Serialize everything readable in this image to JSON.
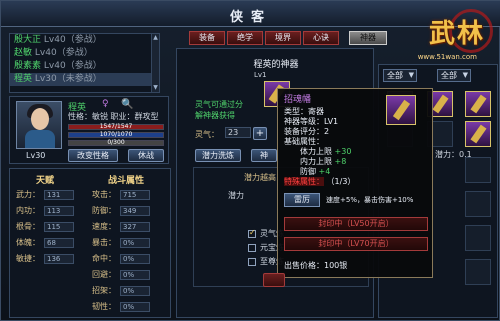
{
  "window": {
    "title": "侠客"
  },
  "logo": {
    "text": "武林",
    "url": "www.51wan.com"
  },
  "list": {
    "rows": [
      {
        "name": "殷大正",
        "level": "Lv40",
        "status": "（参战）",
        "selected": false
      },
      {
        "name": "赵敏",
        "level": "Lv40",
        "status": "（参战）",
        "selected": false
      },
      {
        "name": "殷素素",
        "level": "Lv40",
        "status": "（参战）",
        "selected": false
      },
      {
        "name": "程英",
        "level": "Lv30",
        "status": "（未参战）",
        "selected": true
      }
    ]
  },
  "character": {
    "name": "程英",
    "trait_line": "性格：敏锐    职业：群攻型",
    "level": "Lv30",
    "hp_text": "1547/1547",
    "mp_text": "1070/1070",
    "xp_text": "0/300",
    "change_button": "改变性格",
    "fight_button": "休战"
  },
  "stats": {
    "talent_title": "天赋",
    "battle_title": "战斗属性",
    "talent": [
      {
        "k": "武力：",
        "v": "131"
      },
      {
        "k": "内功：",
        "v": "113"
      },
      {
        "k": "根骨：",
        "v": "115"
      },
      {
        "k": "体魄：",
        "v": "68"
      },
      {
        "k": "敏捷：",
        "v": "136"
      }
    ],
    "battle": [
      {
        "k": "攻击：",
        "v": "715"
      },
      {
        "k": "防御：",
        "v": "349"
      },
      {
        "k": "速度：",
        "v": "327"
      },
      {
        "k": "暴击：",
        "v": "0%"
      },
      {
        "k": "命中：",
        "v": "0%"
      },
      {
        "k": "回避：",
        "v": "0%"
      },
      {
        "k": "招架：",
        "v": "0%"
      },
      {
        "k": "韧性：",
        "v": "0%"
      }
    ]
  },
  "tabs": [
    "装备",
    "绝学",
    "境界",
    "心诀",
    "神器"
  ],
  "main": {
    "title": "程英的神器",
    "level": "Lv1",
    "desc_line1": "灵气可通过分",
    "desc_line2": "解神器获得",
    "lingqi_label": "灵气：",
    "lingqi_value": "23",
    "tab_left": "潜力洗炼",
    "tab_right": "神",
    "inner_title": "潜力越高",
    "inner_sub": "潜力",
    "options": [
      {
        "label": "灵气炼",
        "checked": true
      },
      {
        "label": "元宝炼",
        "checked": false
      },
      {
        "label": "至尊炼",
        "checked": false
      }
    ]
  },
  "right": {
    "filter1": "全部",
    "filter2": "全部",
    "potential": "潜力：0.1"
  },
  "tooltip": {
    "name": "招魂幡",
    "type": "类型：寄器",
    "level": "神器等级：LV1",
    "score": "装备评分：2",
    "base": "基础属性：",
    "attr1_label": "体力上限",
    "attr1_val": "+30",
    "attr2_label": "内力上限",
    "attr2_val": "+8",
    "attr3_label": "防御",
    "attr3_val": "+4",
    "special_label": "特殊属性：",
    "special_val": "（1/3）",
    "effect_tag": "雷厉",
    "effect_text": "速度+5%，暴击伤害+10%",
    "seal1": "封印中（LV50开启）",
    "seal2": "封印中（LV70开启）",
    "price": "出售价格：100银"
  }
}
